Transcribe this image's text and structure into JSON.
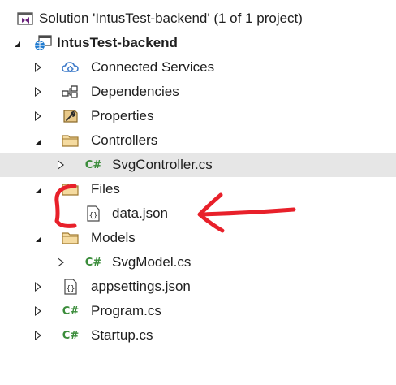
{
  "solution": {
    "label": "Solution 'IntusTest-backend' (1 of 1 project)"
  },
  "tree": {
    "project": "IntusTest-backend",
    "connected_services": "Connected Services",
    "dependencies": "Dependencies",
    "properties": "Properties",
    "controllers": "Controllers",
    "svg_controller": "SvgController.cs",
    "files": "Files",
    "data_json": "data.json",
    "models": "Models",
    "svg_model": "SvgModel.cs",
    "appsettings": "appsettings.json",
    "program": "Program.cs",
    "startup": "Startup.cs"
  },
  "glyphs": {
    "csharp": "C#",
    "json": "{}"
  },
  "icons": {
    "solution": "solution-icon",
    "project": "web-project-icon",
    "connected_services": "connected-services-icon",
    "dependencies": "dependencies-icon",
    "properties": "properties-wrench-icon",
    "folder": "folder-icon",
    "csharp_file": "csharp-file-icon",
    "json_file": "json-file-icon"
  },
  "colors": {
    "selection": "#e6e6e6",
    "csharp": "#3a8c3a",
    "folder": "#dcb67a",
    "annotation": "#e8202a",
    "solution_accent": "#68217a",
    "project_accent": "#1e7ad0"
  }
}
